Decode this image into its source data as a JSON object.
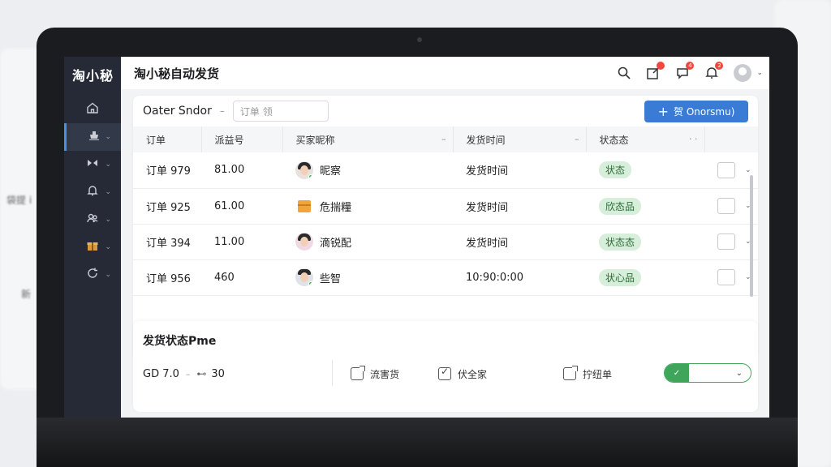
{
  "background": {
    "left_text_1": "袋提 i",
    "left_text_2": "新"
  },
  "app": {
    "logo": "淘小秘",
    "title": "淘小秘自动发货"
  },
  "sidebar": {
    "items": [
      {
        "icon": "home-icon",
        "active": false,
        "has_chevron": false
      },
      {
        "icon": "ship-icon",
        "active": true,
        "has_chevron": true
      },
      {
        "icon": "fold-icon",
        "active": false,
        "has_chevron": true
      },
      {
        "icon": "bell-icon",
        "active": false,
        "has_chevron": true
      },
      {
        "icon": "users-icon",
        "active": false,
        "has_chevron": true
      },
      {
        "icon": "gift-icon",
        "active": false,
        "has_chevron": true
      },
      {
        "icon": "refresh-icon",
        "active": false,
        "has_chevron": true
      }
    ]
  },
  "topbar": {
    "badges": [
      "",
      "4",
      "2"
    ]
  },
  "filter": {
    "label": "Oater Sndor",
    "dash": "–",
    "input_placeholder": "订单  领"
  },
  "primary_button": {
    "plus": "+",
    "label": "贺 Onorsmu)"
  },
  "table": {
    "headers": [
      {
        "label": "订单",
        "suffix": ""
      },
      {
        "label": "派益号",
        "suffix": ""
      },
      {
        "label": "买家昵称",
        "suffix": "–"
      },
      {
        "label": "发货时间",
        "suffix": "–"
      },
      {
        "label": "状态态",
        "suffix": "· ·"
      },
      {
        "label": "",
        "suffix": ""
      }
    ],
    "rows": [
      {
        "order": "订单 979",
        "amount": "81.00",
        "buyer": "昵察",
        "avatar": "woman",
        "time": "发货时间",
        "status": "状态"
      },
      {
        "order": "订单 925",
        "amount": "61.00",
        "buyer": "危揣糧",
        "avatar": "box",
        "time": "发货时间",
        "status": "欣态品"
      },
      {
        "order": "订单 394",
        "amount": "11.00",
        "buyer": "滴锐配",
        "avatar": "woman",
        "time": "发货时间",
        "status": "状态态"
      },
      {
        "order": "订单 956",
        "amount": "460",
        "buyer": "些智",
        "avatar": "man",
        "time": "10:90:0:00",
        "status": "状心品"
      }
    ]
  },
  "panel": {
    "title": "发货状态Pme",
    "gd_label": "GD 7.0",
    "gd_dash": "–",
    "gd_icon": "⊷",
    "gd_value": "30",
    "opt1": "流害货",
    "opt2": "伏全家",
    "opt3": "拧纽单",
    "toggle_icon": "✓"
  }
}
